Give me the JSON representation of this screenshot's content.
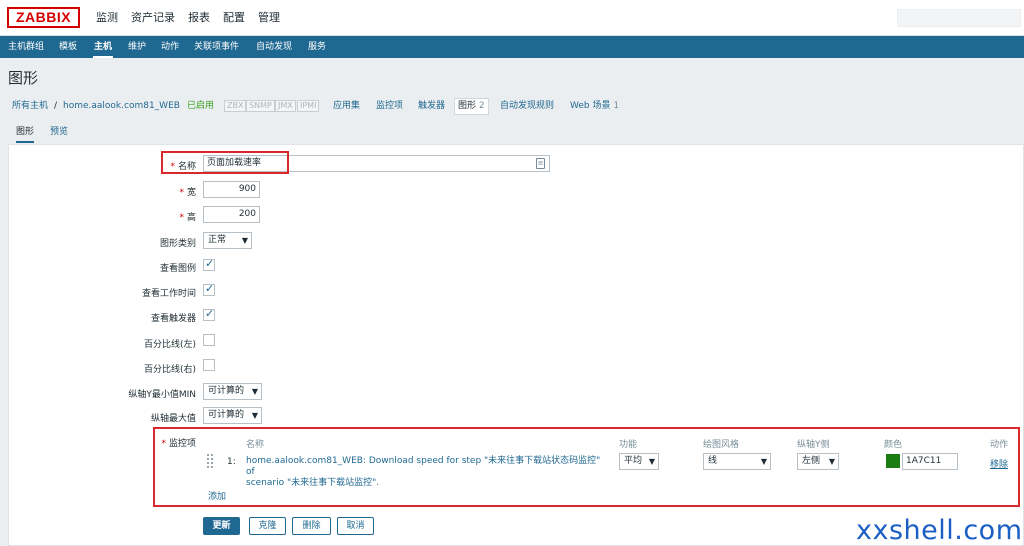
{
  "header": {
    "logo": "ZABBIX",
    "menu": [
      "监测",
      "资产记录",
      "报表",
      "配置",
      "管理"
    ]
  },
  "submenu": [
    "主机群组",
    "模板",
    "主机",
    "维护",
    "动作",
    "关联项事件",
    "自动发现",
    "服务"
  ],
  "page_title": "图形",
  "breadcrumb": {
    "all_hosts": "所有主机",
    "separator": "/",
    "host": "home.aalook.com81_WEB",
    "status": "已启用",
    "tags": [
      "ZBX",
      "SNMP",
      "JMX",
      "IPMI"
    ],
    "links": [
      {
        "label": "应用集",
        "count": ""
      },
      {
        "label": "监控项",
        "count": ""
      },
      {
        "label": "触发器",
        "count": ""
      },
      {
        "label": "图形",
        "count": "2"
      },
      {
        "label": "自动发现规则",
        "count": ""
      },
      {
        "label": "Web 场景",
        "count": "1"
      }
    ]
  },
  "tabs": [
    "图形",
    "预览"
  ],
  "form": {
    "name_label": "名称",
    "name_value": "页面加载速率",
    "width_label": "宽",
    "width_value": "900",
    "height_label": "高",
    "height_value": "200",
    "graph_type_label": "图形类别",
    "graph_type_value": "正常",
    "show_legend_label": "查看图例",
    "show_legend": true,
    "show_working_time_label": "查看工作时间",
    "show_working_time": true,
    "show_triggers_label": "查看触发器",
    "show_triggers": true,
    "percentile_left_label": "百分比线(左)",
    "percentile_left": false,
    "percentile_right_label": "百分比线(右)",
    "percentile_right": false,
    "ymin_label": "纵轴Y最小值MIN",
    "ymin_value": "可计算的",
    "ymax_label": "纵轴最大值",
    "ymax_value": "可计算的",
    "items_label": "监控项"
  },
  "items_table": {
    "headers": {
      "name": "名称",
      "function": "功能",
      "draw_style": "绘图风格",
      "y_axis": "纵轴Y侧",
      "color": "颜色",
      "action": "动作"
    },
    "rows": [
      {
        "index": "1:",
        "name_line1": "home.aalook.com81_WEB: Download speed for step \"未来往事下载站状态码监控\" of",
        "name_line2": "scenario \"未来往事下载站监控\".",
        "function": "平均",
        "draw_style": "线",
        "y_axis": "左侧",
        "color": "1A7C11",
        "remove": "移除"
      }
    ],
    "add": "添加"
  },
  "buttons": {
    "update": "更新",
    "clone": "克隆",
    "delete": "删除",
    "cancel": "取消"
  },
  "watermark": "xxshell.com",
  "colors": {
    "accent": "#1f6891",
    "logo": "#d40000",
    "enabled": "#3ca020",
    "highlight": "#d9292d",
    "item_color": "#1A7C11"
  }
}
